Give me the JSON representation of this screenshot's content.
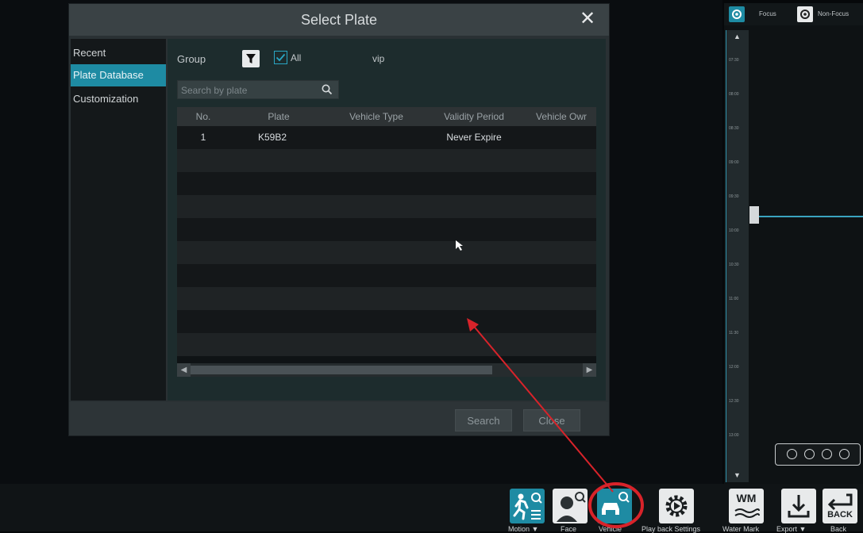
{
  "dialog": {
    "title": "Select Plate",
    "close_symbol": "✕",
    "sidebar": [
      {
        "label": "Recent",
        "active": false
      },
      {
        "label": "Plate Database",
        "active": true
      },
      {
        "label": "Customization",
        "active": false
      }
    ],
    "group_label": "Group",
    "all_label": "All",
    "all_checked": true,
    "group_tag": "vip",
    "search": {
      "placeholder": "Search by plate",
      "value": ""
    },
    "table": {
      "headers": [
        "No.",
        "Plate",
        "Vehicle Type",
        "Validity Period",
        "Vehicle Owr"
      ],
      "rows": [
        [
          "1",
          "K59B2",
          "",
          "Never Expire",
          ""
        ]
      ]
    },
    "footer": {
      "search_label": "Search",
      "close_label": "Close"
    }
  },
  "focus_bar": {
    "focus_label": "Focus",
    "nonfocus_label": "Non-Focus"
  },
  "timeline": {
    "ticks": [
      "07:30",
      "08:00",
      "08:30",
      "09:00",
      "09:30",
      "10:00",
      "10:30",
      "11:00",
      "11:30",
      "12:00",
      "12:30",
      "13:00"
    ]
  },
  "toolbar": {
    "motion_label": "Motion ▼",
    "face_label": "Face",
    "vehicle_label": "Vehicle",
    "playback_label": "Play back Settings",
    "watermark_label": "Water Mark",
    "export_label": "Export ▼",
    "back_label": "Back",
    "back_text": "BACK",
    "wm_text": "WM",
    "icons": [
      "motion-search-icon",
      "face-search-icon",
      "vehicle-search-icon",
      "playback-settings-icon",
      "watermark-icon",
      "export-icon",
      "back-icon"
    ]
  },
  "colors": {
    "accent": "#1e8ba3",
    "highlight_circle": "#d8232a",
    "arrow": "#d8232a"
  }
}
